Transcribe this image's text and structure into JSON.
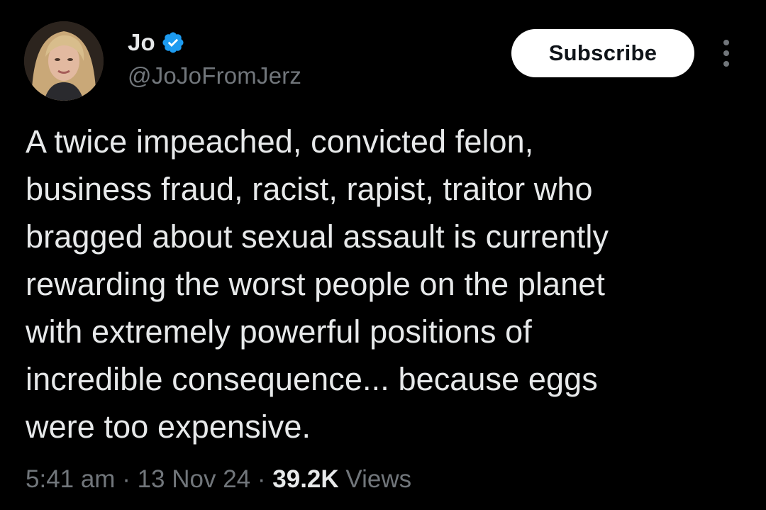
{
  "author": {
    "display_name": "Jo",
    "handle": "@JoJoFromJerz",
    "verified_icon": "verified-badge-icon",
    "avatar_icon": "avatar-photo"
  },
  "actions": {
    "subscribe_label": "Subscribe",
    "more_icon": "more-options-icon"
  },
  "tweet": {
    "lines": [
      "A twice impeached, convicted felon,",
      "business fraud, racist, rapist, traitor who",
      "bragged about sexual assault is currently",
      "rewarding the worst people on the planet",
      "with extremely powerful positions of",
      "incredible consequence... because eggs",
      "were too expensive."
    ]
  },
  "meta": {
    "time": "5:41 am",
    "separator": "·",
    "date": "13 Nov 24",
    "views_count": "39.2K",
    "views_label": "Views"
  },
  "colors": {
    "background": "#000000",
    "primary_text": "#e7e9ea",
    "secondary_text": "#71767b",
    "verified_blue": "#1d9bf0",
    "button_bg": "#ffffff"
  }
}
